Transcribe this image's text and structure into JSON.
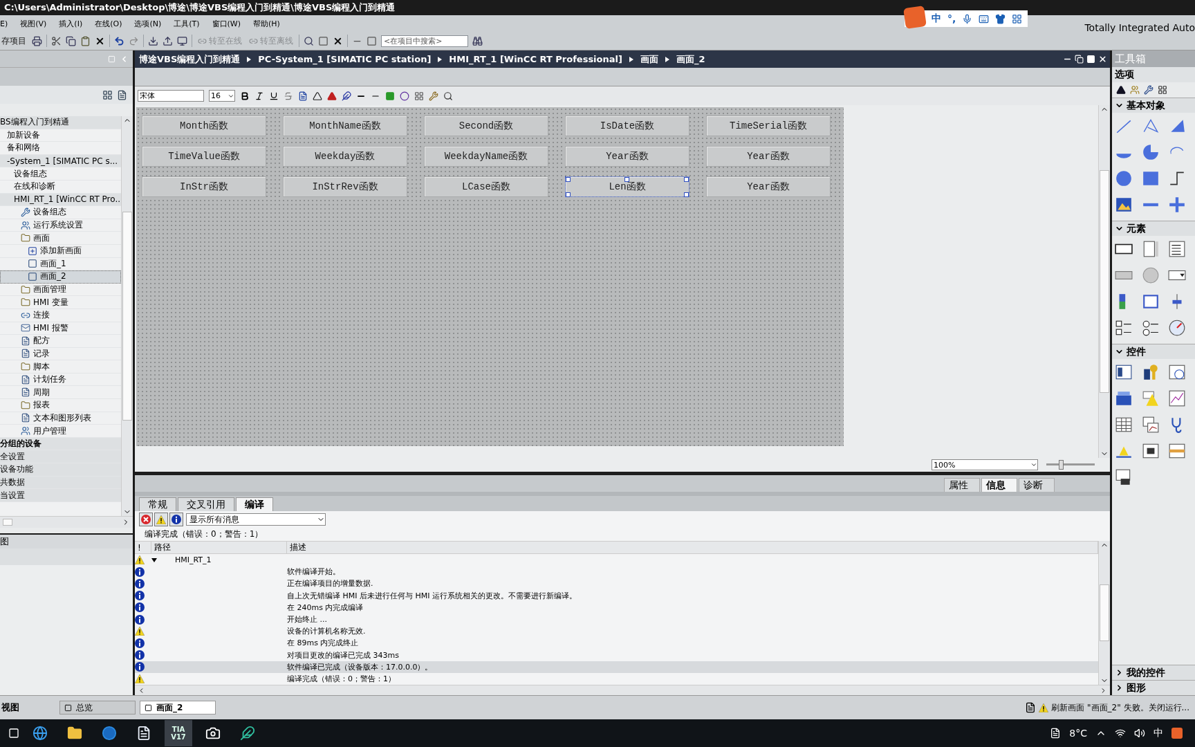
{
  "window": {
    "title": "C:\\Users\\Administrator\\Desktop\\博途\\博途VBS编程入门到精通\\博途VBS编程入门到精通"
  },
  "ime_bar": {
    "mode": "中",
    "punct": "°,"
  },
  "menu": [
    "E)",
    "视图(V)",
    "插入(I)",
    "在线(O)",
    "选项(N)",
    "工具(T)",
    "窗口(W)",
    "帮助(H)"
  ],
  "toolbar": {
    "save_label": "存项目",
    "go_online": "转至在线",
    "go_offline": "转至离线",
    "online_disabled": true,
    "search": {
      "placeholder": "<在项目中搜索>"
    }
  },
  "brand": "Totally Integrated Auto",
  "left_panel": {
    "tree": [
      {
        "label": "BS编程入门到精通",
        "kind": "header",
        "selected": false,
        "children": [
          {
            "label": "加新设备",
            "kind": "plain",
            "selected": false
          },
          {
            "label": "备和网络",
            "kind": "plain",
            "selected": false
          },
          {
            "label": "-System_1 [SIMATIC PC s...",
            "kind": "header",
            "selected": false,
            "children": [
              {
                "label": "设备组态",
                "kind": "plain",
                "selected": false
              },
              {
                "label": "在线和诊断",
                "kind": "plain",
                "selected": false
              },
              {
                "label": "HMI_RT_1 [WinCC RT Pro...",
                "kind": "header",
                "selected": false,
                "children": [
                  {
                    "label": "设备组态",
                    "kind": "device",
                    "selected": false
                  },
                  {
                    "label": "运行系统设置",
                    "kind": "tool",
                    "selected": false
                  },
                  {
                    "label": "画面",
                    "kind": "folder",
                    "selected": false,
                    "children": [
                      {
                        "label": "添加新画面",
                        "kind": "add",
                        "selected": false
                      },
                      {
                        "label": "画面_1",
                        "kind": "screen",
                        "selected": false
                      },
                      {
                        "label": "画面_2",
                        "kind": "screen",
                        "selected": true
                      }
                    ]
                  },
                  {
                    "label": "画面管理",
                    "kind": "folder",
                    "selected": false
                  },
                  {
                    "label": "HMI 变量",
                    "kind": "folder",
                    "selected": false
                  },
                  {
                    "label": "连接",
                    "kind": "link",
                    "selected": false
                  },
                  {
                    "label": "HMI 报警",
                    "kind": "mail",
                    "selected": false
                  },
                  {
                    "label": "配方",
                    "kind": "doc",
                    "selected": false
                  },
                  {
                    "label": "记录",
                    "kind": "doc",
                    "selected": false
                  },
                  {
                    "label": "脚本",
                    "kind": "folder",
                    "selected": false
                  },
                  {
                    "label": "计划任务",
                    "kind": "doc",
                    "selected": false
                  },
                  {
                    "label": "周期",
                    "kind": "doc",
                    "selected": false
                  },
                  {
                    "label": "报表",
                    "kind": "folder",
                    "selected": false
                  },
                  {
                    "label": "文本和图形列表",
                    "kind": "doc",
                    "selected": false
                  },
                  {
                    "label": "用户管理",
                    "kind": "tool",
                    "selected": false
                  }
                ]
              }
            ]
          }
        ]
      },
      {
        "label": "分组的设备",
        "kind": "group",
        "selected": false
      },
      {
        "label": "全设置",
        "kind": "header",
        "selected": false
      },
      {
        "label": "设备功能",
        "kind": "header",
        "selected": false
      },
      {
        "label": "共数据",
        "kind": "header",
        "selected": false
      },
      {
        "label": "当设置",
        "kind": "header",
        "selected": false
      }
    ],
    "details_title": "图"
  },
  "editor": {
    "breadcrumb": [
      "博途VBS编程入门到精通",
      "PC-System_1 [SIMATIC PC station]",
      "HMI_RT_1 [WinCC RT Professional]",
      "画面",
      "画面_2"
    ],
    "font": "宋体",
    "font_size": "16",
    "buttons": [
      {
        "label": "Month函数",
        "selected": false
      },
      {
        "label": "MonthName函数",
        "selected": false
      },
      {
        "label": "Second函数",
        "selected": false
      },
      {
        "label": "IsDate函数",
        "selected": false
      },
      {
        "label": "TimeSerial函数",
        "selected": false
      },
      {
        "label": "TimeValue函数",
        "selected": false
      },
      {
        "label": "Weekday函数",
        "selected": false
      },
      {
        "label": "WeekdayName函数",
        "selected": false
      },
      {
        "label": "Year函数",
        "selected": false
      },
      {
        "label": "Year函数",
        "selected": false
      },
      {
        "label": "InStr函数",
        "selected": false
      },
      {
        "label": "InStrRev函数",
        "selected": false
      },
      {
        "label": "LCase函数",
        "selected": false
      },
      {
        "label": "Len函数",
        "selected": true
      },
      {
        "label": "Year函数",
        "selected": false
      }
    ],
    "zoom": "100%",
    "zoom_slider": {
      "level": 0.25
    }
  },
  "inspector": {
    "side_tabs": [
      {
        "label": "属性",
        "selected": false
      },
      {
        "label": "信息",
        "selected": true
      },
      {
        "label": "诊断",
        "selected": false
      }
    ],
    "tabs": [
      {
        "label": "常规",
        "selected": false
      },
      {
        "label": "交叉引用",
        "selected": false
      },
      {
        "label": "编译",
        "selected": true
      }
    ],
    "filters": [
      {
        "kind": "error",
        "on": true
      },
      {
        "kind": "warning",
        "on": true
      },
      {
        "kind": "info",
        "on": true
      }
    ],
    "filter_select": "显示所有消息",
    "summary": "编译完成（错误：0；警告：1）",
    "columns": [
      "!",
      "路径",
      "描述"
    ],
    "rows": [
      {
        "kind": "warning",
        "path": "HMI_RT_1",
        "expanded": true,
        "selected": false
      },
      {
        "kind": "info",
        "description": "软件编译开始。",
        "selected": false
      },
      {
        "kind": "info",
        "description": "正在编译项目的增量数据.",
        "selected": false
      },
      {
        "kind": "info",
        "description": "自上次无错编译 HMI 后未进行任何与 HMI 运行系统相关的更改。不需要进行新编译。",
        "selected": false
      },
      {
        "kind": "info",
        "description": "在 240ms 内完成编译",
        "selected": false
      },
      {
        "kind": "info",
        "description": "开始终止 ...",
        "selected": false
      },
      {
        "kind": "warning",
        "description": "设备的计算机名称无效.",
        "selected": false
      },
      {
        "kind": "info",
        "description": "在 89ms 内完成终止",
        "selected": false
      },
      {
        "kind": "info",
        "description": "对项目更改的编译已完成 343ms",
        "selected": false
      },
      {
        "kind": "info",
        "description": "软件编译已完成（设备版本：17.0.0.0）。",
        "selected": true
      },
      {
        "kind": "warning",
        "description": "编译完成（错误：0；警告：1）",
        "selected": false
      }
    ]
  },
  "toolbox": {
    "title": "工具箱",
    "options_title": "选项",
    "sections": [
      {
        "title": "基本对象",
        "kind": "basic",
        "expanded": true
      },
      {
        "title": "元素",
        "kind": "elements",
        "expanded": true
      },
      {
        "title": "控件",
        "kind": "controls",
        "expanded": true
      },
      {
        "title": "我的控件",
        "expanded": false
      },
      {
        "title": "图形",
        "expanded": false
      }
    ]
  },
  "status_bar": {
    "portal_view": "视图",
    "tabs": [
      {
        "label": "总览",
        "selected": false
      },
      {
        "label": "画面_2",
        "selected": true
      }
    ],
    "message": "刷新画面 \"画面_2\" 失败。关闭运行..."
  },
  "taskbar": {
    "apps": [
      {
        "kind": "edge"
      },
      {
        "kind": "explorer"
      },
      {
        "kind": "k"
      },
      {
        "kind": "doc"
      },
      {
        "kind": "tia",
        "label": "TIA V17",
        "selected": true
      },
      {
        "kind": "camera"
      },
      {
        "kind": "bird"
      }
    ],
    "temperature": "8°C",
    "ime": "中"
  }
}
